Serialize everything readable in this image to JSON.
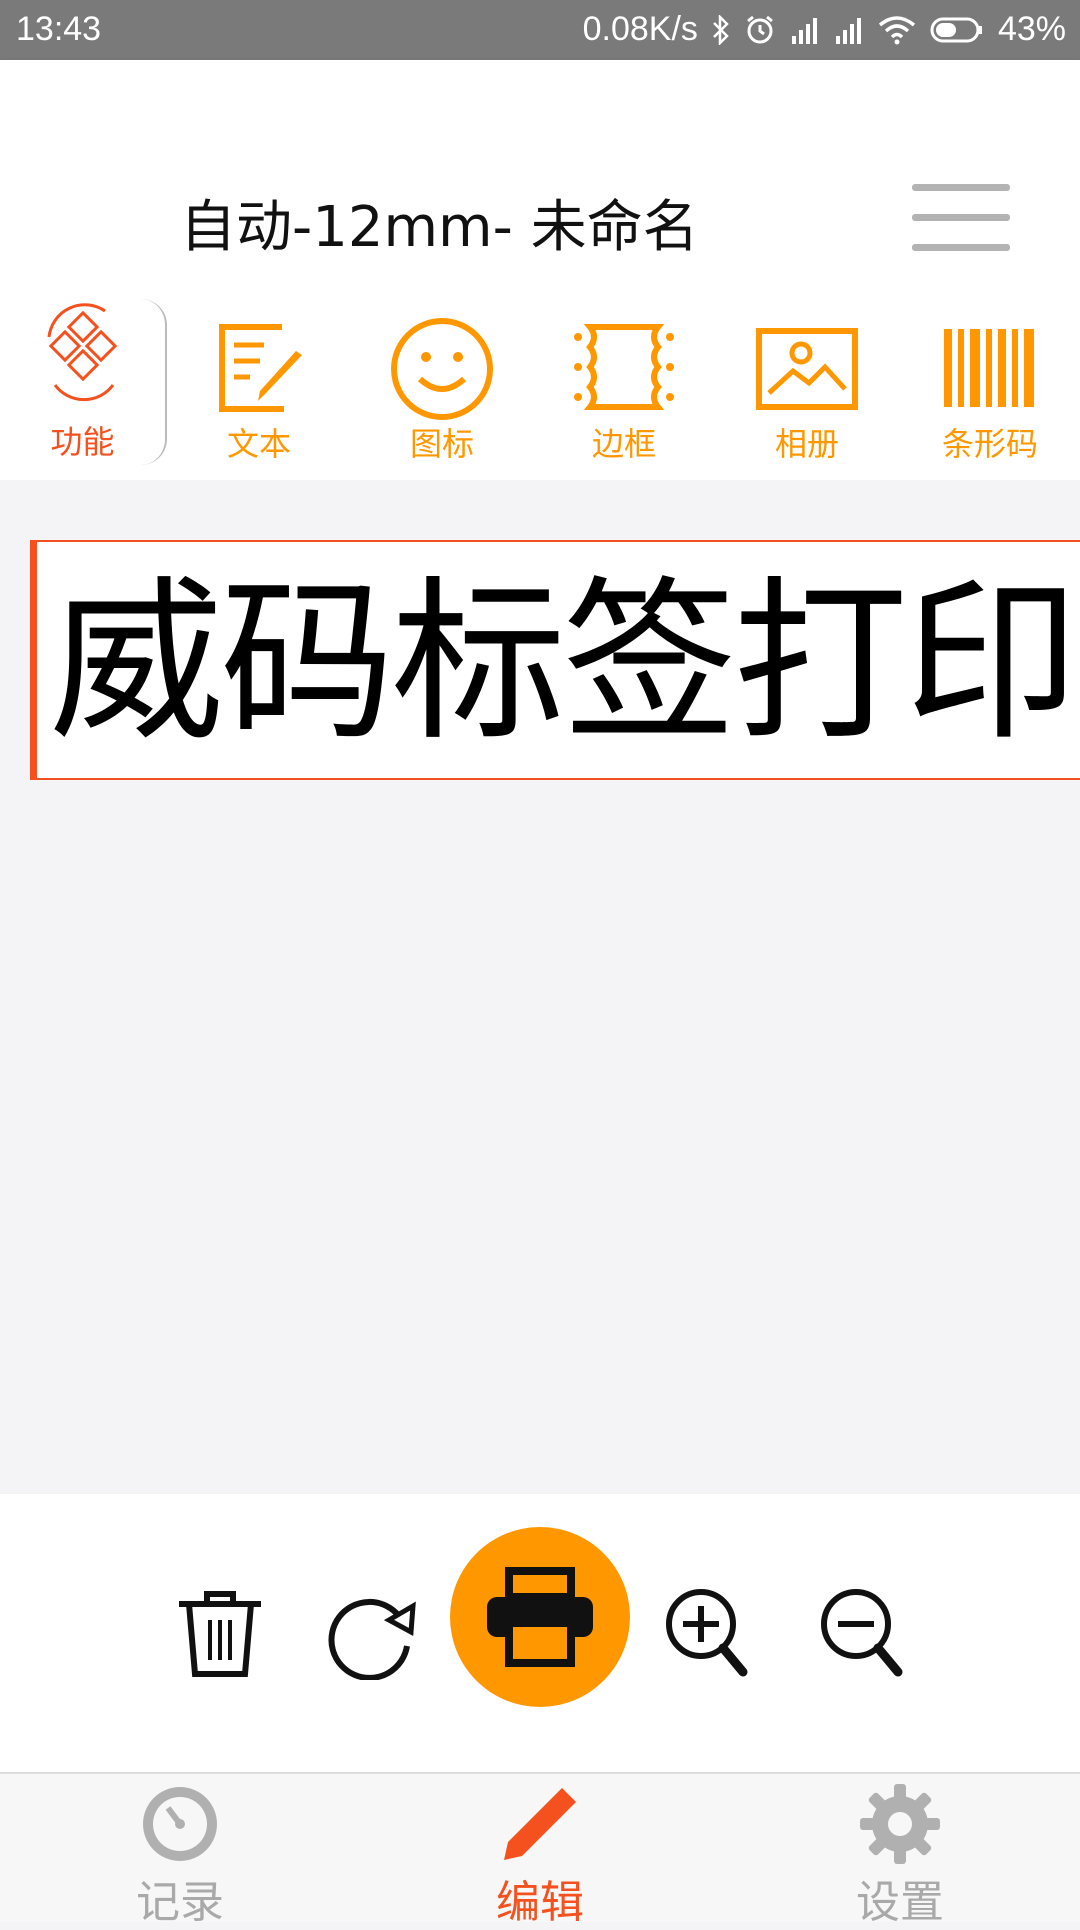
{
  "status_bar": {
    "time": "13:43",
    "speed": "0.08K/s",
    "battery": "43%",
    "icons": [
      "bluetooth-icon",
      "alarm-icon",
      "signal-icon",
      "signal-icon",
      "wifi-icon",
      "battery-icon"
    ]
  },
  "header": {
    "title": "自动-12mm- 未命名",
    "menu_icon": "hamburger-menu-icon"
  },
  "toolbar": {
    "function_label": "功能",
    "items": [
      {
        "label": "文本",
        "icon": "text-edit-icon"
      },
      {
        "label": "图标",
        "icon": "smiley-icon"
      },
      {
        "label": "边框",
        "icon": "border-frame-icon"
      },
      {
        "label": "相册",
        "icon": "photo-album-icon"
      },
      {
        "label": "条形码",
        "icon": "barcode-icon"
      }
    ],
    "accent": "#ff9800",
    "active_color": "#f4511e"
  },
  "canvas": {
    "label_text": "威码标签打印"
  },
  "actions": {
    "icons": [
      "trash-icon",
      "rotate-icon",
      "printer-icon",
      "zoom-in-icon",
      "zoom-out-icon"
    ]
  },
  "bottom_nav": {
    "items": [
      {
        "label": "记录",
        "icon": "history-icon"
      },
      {
        "label": "编辑",
        "icon": "pencil-icon"
      },
      {
        "label": "设置",
        "icon": "gear-icon"
      }
    ],
    "active": "编辑"
  }
}
